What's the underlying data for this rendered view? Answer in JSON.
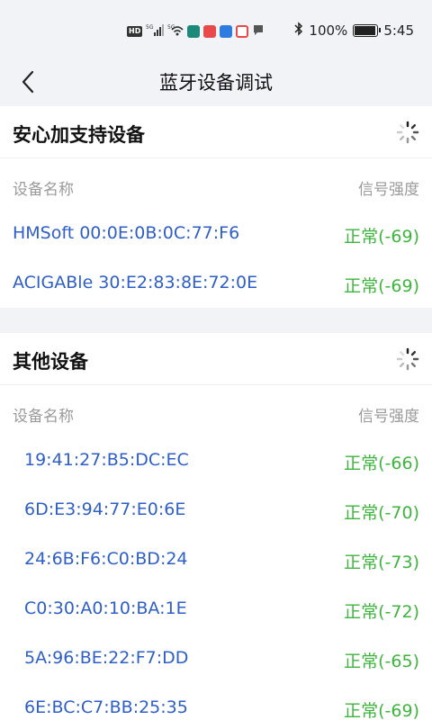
{
  "status_bar": {
    "hd_badge": "HD",
    "net_1": "5G",
    "net_2": "5G",
    "battery_percent": "100%",
    "battery_level": 1.0,
    "time": "5:45"
  },
  "nav": {
    "title": "蓝牙设备调试"
  },
  "colors": {
    "link_blue": "#2e5ec9",
    "signal_green": "#3db53d",
    "header_gray": "#9a9a9a",
    "page_bg": "#f2f3f7"
  },
  "sections": [
    {
      "title": "安心加支持设备",
      "col_name": "设备名称",
      "col_signal": "信号强度",
      "devices": [
        {
          "name": "HMSoft   00:0E:0B:0C:77:F6",
          "signal": "正常(-69)"
        },
        {
          "name": "ACIGABle   30:E2:83:8E:72:0E",
          "signal": "正常(-69)"
        }
      ]
    },
    {
      "title": "其他设备",
      "col_name": "设备名称",
      "col_signal": "信号强度",
      "devices": [
        {
          "name": "19:41:27:B5:DC:EC",
          "signal": "正常(-66)"
        },
        {
          "name": "6D:E3:94:77:E0:6E",
          "signal": "正常(-70)"
        },
        {
          "name": "24:6B:F6:C0:BD:24",
          "signal": "正常(-73)"
        },
        {
          "name": "C0:30:A0:10:BA:1E",
          "signal": "正常(-72)"
        },
        {
          "name": "5A:96:BE:22:F7:DD",
          "signal": "正常(-65)"
        },
        {
          "name": "6E:BC:C7:BB:25:35",
          "signal": "正常(-69)"
        }
      ]
    }
  ]
}
